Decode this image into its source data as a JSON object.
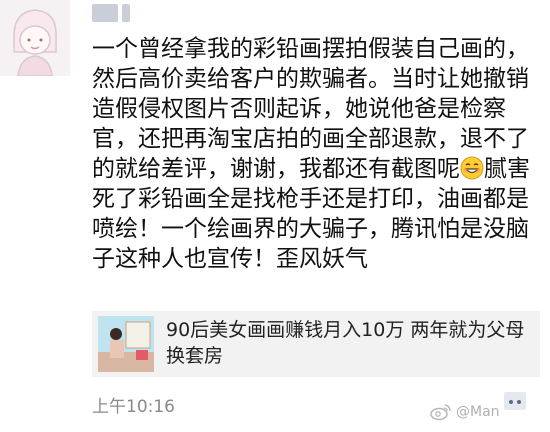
{
  "post": {
    "text": "一个曾经拿我的彩铅画摆拍假装自己画的，然后高价卖给客户的欺骗者。当时让她撤销造假侵权图片否则起诉，她说他爸是检察官，还把再淘宝店拍的画全部退款，退不了的就给差评，谢谢，我都还有截图呢",
    "text_after_emoji": "腻害死了彩铅画全是找枪手还是打印，油画都是喷绘！一个绘画界的大骗子，腾讯怕是没脑子这种人也宣传！歪风妖气",
    "emoji_icon": "grinning-face-emoji"
  },
  "link_card": {
    "title": "90后美女画画赚钱月入10万 两年就为父母换套房"
  },
  "footer": {
    "time": "上午10:16"
  },
  "watermark": {
    "handle": "@Man"
  },
  "colors": {
    "text": "#111111",
    "meta": "#8a8a8a",
    "card_bg": "#f2f2f2"
  }
}
